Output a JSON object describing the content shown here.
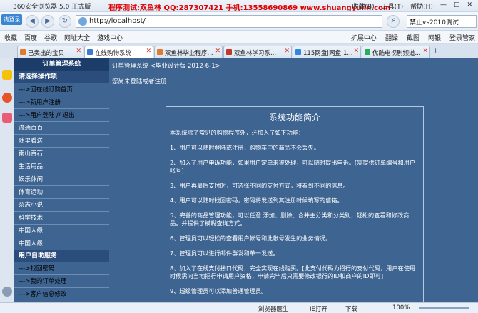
{
  "window": {
    "app_title": "360安全浏览器 5.0 正式版",
    "promo_text": "程序测试:双鱼林 QQ:287307421 手机:13558690869 www.shuangyulin.com",
    "menu": [
      "收藏(B)",
      "工具(T)",
      "帮助(H)"
    ]
  },
  "login_badge": "请登录",
  "address_bar": {
    "url": "http://localhost/"
  },
  "search_box": {
    "value": "禁止vs2010调试"
  },
  "favorites": {
    "items": [
      "收藏",
      "百度",
      "谷歌",
      "网址大全",
      "游戏中心"
    ],
    "right": [
      "扩展中心",
      "翻译",
      "截图",
      "网银",
      "登录管家"
    ]
  },
  "tabs": [
    "已卖出的宝贝",
    "在线购物系统",
    "双鱼林毕业程序...",
    "双鱼林学习系...",
    "115网盘|网盘|1...",
    "优酷电视剧频道..."
  ],
  "left_nav": {
    "header": "订单管理系统",
    "section1": "请选择操作项",
    "items1": [
      "--->回在线订购首页",
      "--->新用户注册",
      "--->用户登陆 // 退出"
    ],
    "categories": [
      "流通百百",
      "随里看送",
      "南山百石",
      "生活用品",
      "娱乐休闲",
      "体育运动",
      "杂志小说",
      "科学技术",
      "中国人缘",
      "中国人缘"
    ],
    "section2": "用户自助服务",
    "items2": [
      "--->找回密码",
      "--->我的订单处理",
      "--->客户信息修改"
    ]
  },
  "main": {
    "breadcrumb": "订单管理系统 <毕业设计版 2012-6-1>",
    "login_hint": "您尚未登陆或者注册",
    "panel_title": "系统功能简介",
    "panel_paragraphs": [
      "本系统除了常见的购物程序外，还加入了如下功能：",
      "1、用户可以随时登陆或注册，购物车中的商品不会丢失。",
      "2、加入了用户申诉功能，如果用户定单未被处理，可以随时提出申诉。[需提供订单编号和用户帐号]",
      "3、用户再最后支付时，可选择不同的支付方式，将看到不同的信息。",
      "4、用户可以随时找回密码，密码将发送到其注册时候填写的信箱。",
      "5、完善的商品管理功能，可以任意 添加、删除、合并主分类和分类别，轻松的查看和修改商品。并提供了模糊查询方式。",
      "6、管理员可以轻松的查看用户帐号和此帐号发生的业务情况。",
      "7、管理员可以进行邮件群发和单一发送。",
      "8、加入了在线支付接口代码，完全实现在线购买。[此支付代码为招行的支付代码，用户在使用时候需向当地招行申请用户资格，申请完毕后只需要修改银行的ID和商户的ID即可]",
      "9、超级管理员可以添加普通管理员。"
    ]
  },
  "statusbar": {
    "doctor": "浏览器医生",
    "ie": "IE打开",
    "download": "下载",
    "zoom": "100%"
  }
}
